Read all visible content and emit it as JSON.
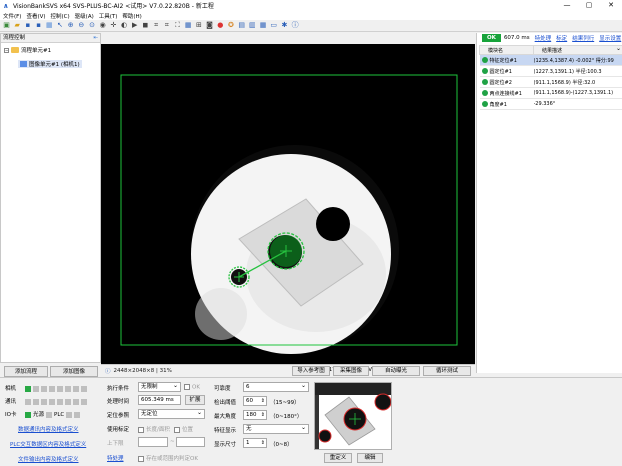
{
  "window": {
    "title": "VisionBankSVS x64 SVS-PLUS-BC-AI2 <试用> V7.0.22.820B - 新工程",
    "minimize": "—",
    "maximize": "▢",
    "close": "✕"
  },
  "menu": [
    "文件(F)",
    "查看(V)",
    "控制(C)",
    "驱级(A)",
    "工具(T)",
    "帮助(H)"
  ],
  "left_panel": {
    "header": "流程控制",
    "pin": "⇤",
    "tree_root": "流程单元#1",
    "tree_child": "图像单元#1 (相机1)",
    "add_flow_btn": "添加流程",
    "add_image_btn": "添加图像"
  },
  "image_status": {
    "info": "2448×2048×8 | 31%",
    "coords": "X:1795 Y:2047 | V:12",
    "import_btn": "导入参考图",
    "capture_btn": "采集图像",
    "auto_exposure_btn": "自动曝光",
    "loop_test_btn": "循环测试"
  },
  "right_panel": {
    "ok": "OK",
    "time": "607.0 ms",
    "links": [
      "特处理",
      "标定",
      "结果列行",
      "显示设置"
    ],
    "columns": [
      "模块名",
      "结果描述"
    ],
    "rows": [
      {
        "name": "特征定位#1",
        "desc": "(1235.4,1387.4) -0.002° 得分:99"
      },
      {
        "name": "圆定位#1",
        "desc": "(1227.3,1391.1) 半径:100.3"
      },
      {
        "name": "圆定位#2",
        "desc": "(911.1,1568.9) 半径:32.0"
      },
      {
        "name": "两点连接线#1",
        "desc": "(911.1,1568.9)-(1227.3,1391.1)"
      },
      {
        "name": "角度#1",
        "desc": "-29.336°"
      }
    ]
  },
  "bottom_left": {
    "camera": "相机",
    "comm": "通讯",
    "io": "IO卡",
    "light": "光源",
    "plc": "PLC",
    "link1": "数据通讯内容及格式定义",
    "link2": "PLC交互数据区内容及格式定义",
    "link3": "文件输出内容及格式定义"
  },
  "params": {
    "exec_cond_label": "执行条件",
    "exec_cond": "无限制",
    "ok_label": "OK",
    "proc_time_label": "处理时间",
    "proc_time": "605.349 ms",
    "expand_btn": "扩展",
    "locator_label": "定位参照",
    "locator": "无定位",
    "calib_label": "使用标定",
    "calib_opt1": "长度/面积",
    "calib_opt2": "位置",
    "bounds_label": "上下限",
    "bounds_sep": "~",
    "post_link": "特处理",
    "save_fail": "存在或范围内判定OK"
  },
  "params2": {
    "pyramid_label": "可靠度",
    "pyramid": "6",
    "thresh_label": "检出阈值",
    "thresh": "60",
    "thresh_range": "（15~99）",
    "angle_label": "最大角度",
    "angle": "180",
    "angle_range": "（0~180°）",
    "feature_label": "特征显示",
    "feature": "无",
    "size_label": "显示尺寸",
    "size": "1",
    "size_range": "（0~8）",
    "redefine_btn": "重定义",
    "edit_btn": "编辑"
  }
}
